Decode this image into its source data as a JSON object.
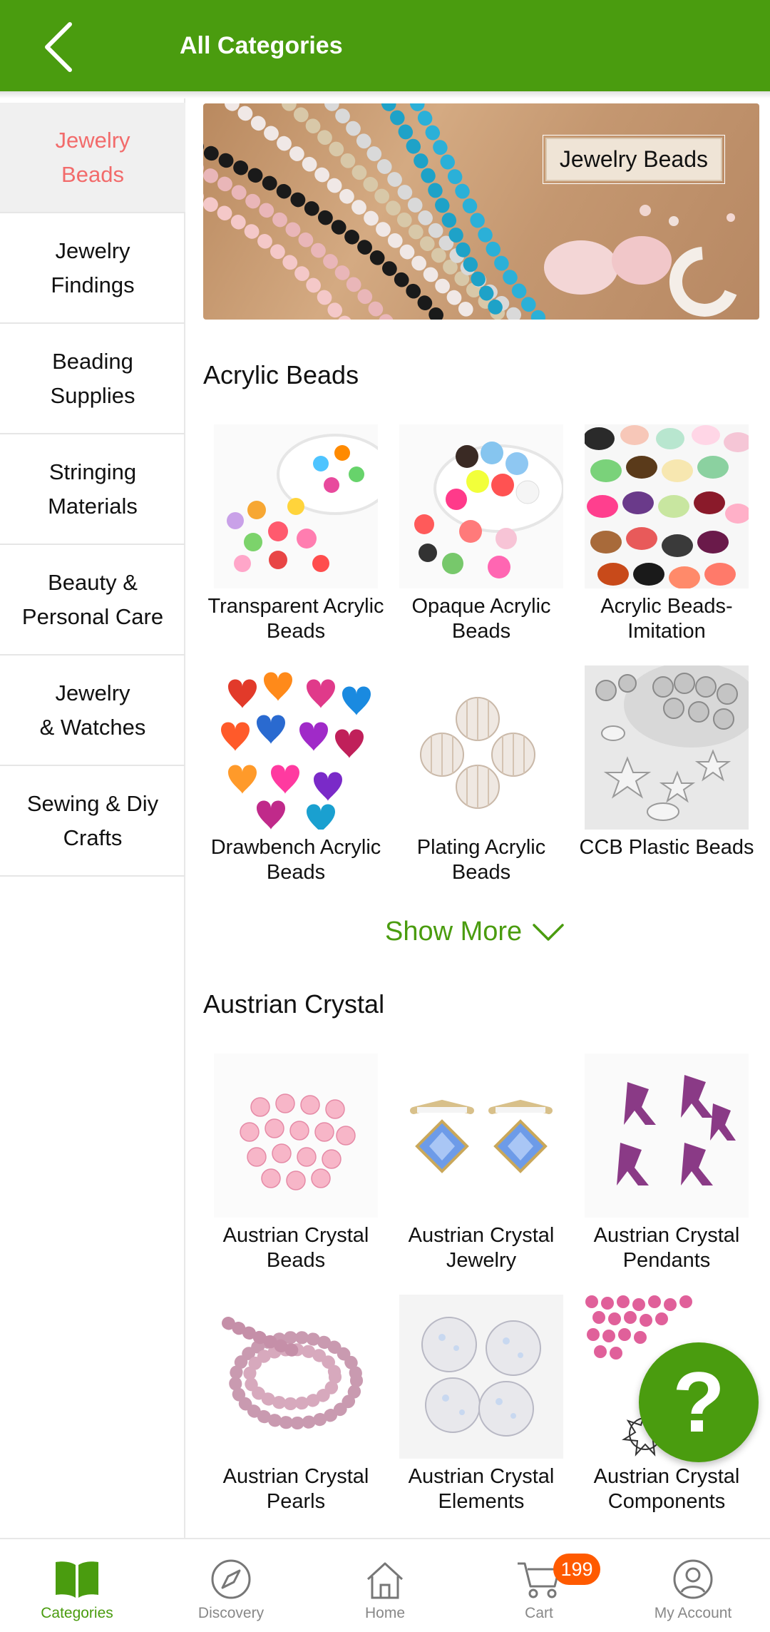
{
  "header": {
    "title": "All Categories",
    "accent": "#4a9c0f"
  },
  "sidebar": {
    "items": [
      {
        "label": "Jewelry\nBeads",
        "active": true
      },
      {
        "label": "Jewelry\nFindings"
      },
      {
        "label": "Beading\nSupplies"
      },
      {
        "label": "Stringing\nMaterials"
      },
      {
        "label": "Beauty &\nPersonal Care"
      },
      {
        "label": "Jewelry\n& Watches"
      },
      {
        "label": "Sewing & Diy\nCrafts"
      }
    ]
  },
  "banner": {
    "label": "Jewelry Beads"
  },
  "sections": [
    {
      "title": "Acrylic Beads",
      "products": [
        {
          "label": "Transparent Acrylic Beads",
          "icon": "colorful-beads"
        },
        {
          "label": "Opaque Acrylic Beads",
          "icon": "opaque-beads"
        },
        {
          "label": "Acrylic Beads-Imitation",
          "icon": "imitation-beads"
        },
        {
          "label": "Drawbench Acrylic Beads",
          "icon": "heart-beads"
        },
        {
          "label": "Plating Acrylic Beads",
          "icon": "clear-beads"
        },
        {
          "label": "CCB Plastic Beads",
          "icon": "silver-beads"
        }
      ],
      "show_more": "Show More"
    },
    {
      "title": "Austrian Crystal",
      "products": [
        {
          "label": "Austrian Crystal Beads",
          "icon": "pink-crystal"
        },
        {
          "label": "Austrian Crystal Jewelry",
          "icon": "crystal-earrings"
        },
        {
          "label": "Austrian Crystal Pendants",
          "icon": "purple-pendants"
        },
        {
          "label": "Austrian Crystal Pearls",
          "icon": "pearl-strand"
        },
        {
          "label": "Austrian Crystal Elements",
          "icon": "crystal-balls"
        },
        {
          "label": "Austrian Crystal Components",
          "icon": "pink-rhinestones"
        }
      ]
    }
  ],
  "help": {
    "symbol": "?"
  },
  "bottom_nav": [
    {
      "label": "Categories",
      "icon": "book-icon",
      "active": true
    },
    {
      "label": "Discovery",
      "icon": "compass-icon"
    },
    {
      "label": "Home",
      "icon": "home-icon"
    },
    {
      "label": "Cart",
      "icon": "cart-icon",
      "badge": "199"
    },
    {
      "label": "My Account",
      "icon": "account-icon"
    }
  ]
}
